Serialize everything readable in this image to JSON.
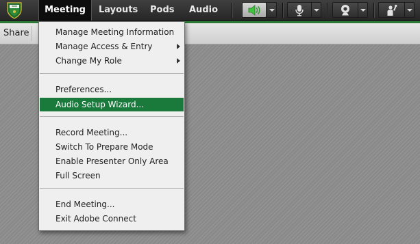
{
  "menubar": {
    "logo_icon": "shield-crest-icon",
    "items": [
      {
        "label": "Meeting",
        "active": true
      },
      {
        "label": "Layouts"
      },
      {
        "label": "Pods"
      },
      {
        "label": "Audio"
      }
    ],
    "toolbar": {
      "speaker_icon": "speaker-icon",
      "mic_icon": "microphone-icon",
      "camera_icon": "webcam-icon",
      "raise_hand_icon": "raise-hand-icon",
      "speaker_status_color": "#3ec43e"
    },
    "accent_color": "#2c7a35"
  },
  "sharebar": {
    "label": "Share"
  },
  "meeting_menu": {
    "items": [
      {
        "label": "Manage Meeting Information",
        "submenu": false
      },
      {
        "label": "Manage Access & Entry",
        "submenu": true
      },
      {
        "label": "Change My Role",
        "submenu": true
      },
      {
        "label": "Preferences...",
        "submenu": false
      },
      {
        "label": "Audio Setup Wizard...",
        "submenu": false,
        "selected": true
      },
      {
        "label": "Record Meeting...",
        "submenu": false
      },
      {
        "label": "Switch To Prepare Mode",
        "submenu": false
      },
      {
        "label": "Enable Presenter Only Area",
        "submenu": false
      },
      {
        "label": "Full Screen",
        "submenu": false
      },
      {
        "label": "End Meeting...",
        "submenu": false
      },
      {
        "label": "Exit Adobe Connect",
        "submenu": false
      }
    ],
    "selected_color": "#1a7a3c"
  }
}
